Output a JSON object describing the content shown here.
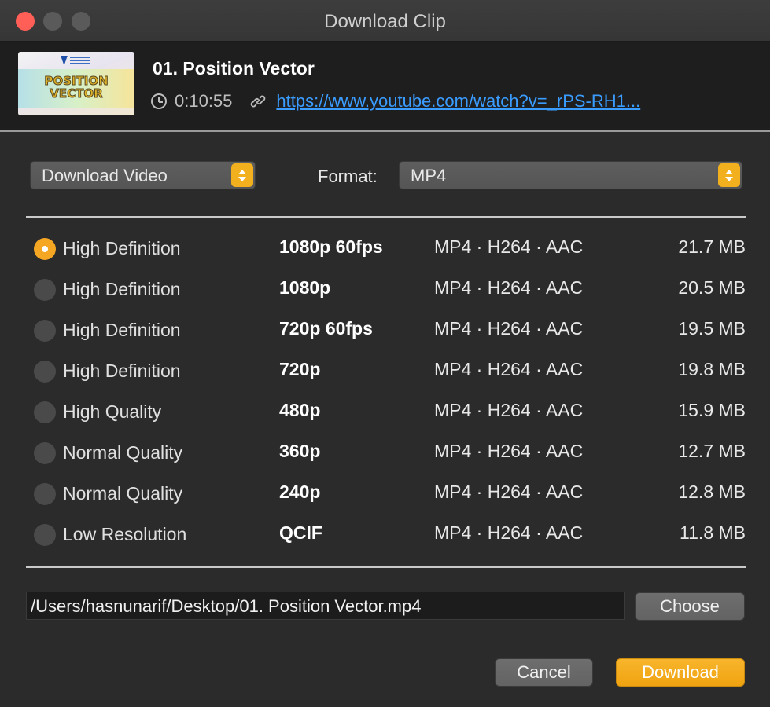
{
  "window": {
    "title": "Download Clip"
  },
  "header": {
    "thumbnail": {
      "line1": "POSITION",
      "line2": "VECTOR"
    },
    "clip_title": "01. Position Vector",
    "duration": "0:10:55",
    "url": "https://www.youtube.com/watch?v=_rPS-RH1..."
  },
  "controls": {
    "mode_value": "Download Video",
    "format_label": "Format:",
    "format_value": "MP4"
  },
  "options": [
    {
      "quality": "High Definition",
      "resolution": "1080p 60fps",
      "codec": "MP4 · H264 · AAC",
      "size": "21.7 MB",
      "selected": true
    },
    {
      "quality": "High Definition",
      "resolution": "1080p",
      "codec": "MP4 · H264 · AAC",
      "size": "20.5 MB",
      "selected": false
    },
    {
      "quality": "High Definition",
      "resolution": "720p 60fps",
      "codec": "MP4 · H264 · AAC",
      "size": "19.5 MB",
      "selected": false
    },
    {
      "quality": "High Definition",
      "resolution": "720p",
      "codec": "MP4 · H264 · AAC",
      "size": "19.8 MB",
      "selected": false
    },
    {
      "quality": "High Quality",
      "resolution": "480p",
      "codec": "MP4 · H264 · AAC",
      "size": "15.9 MB",
      "selected": false
    },
    {
      "quality": "Normal Quality",
      "resolution": "360p",
      "codec": "MP4 · H264 · AAC",
      "size": "12.7 MB",
      "selected": false
    },
    {
      "quality": "Normal Quality",
      "resolution": "240p",
      "codec": "MP4 · H264 · AAC",
      "size": "12.8 MB",
      "selected": false
    },
    {
      "quality": "Low Resolution",
      "resolution": "QCIF",
      "codec": "MP4 · H264 · AAC",
      "size": "11.8 MB",
      "selected": false
    }
  ],
  "save": {
    "path": "/Users/hasnunarif/Desktop/01. Position Vector.mp4",
    "choose_label": "Choose"
  },
  "footer": {
    "cancel_label": "Cancel",
    "download_label": "Download"
  },
  "colors": {
    "accent": "#f5a623",
    "link": "#3a9cff",
    "close_button": "#ff5f57"
  },
  "icons": [
    "clock-icon",
    "link-icon",
    "chevron-up-icon",
    "chevron-down-icon"
  ]
}
